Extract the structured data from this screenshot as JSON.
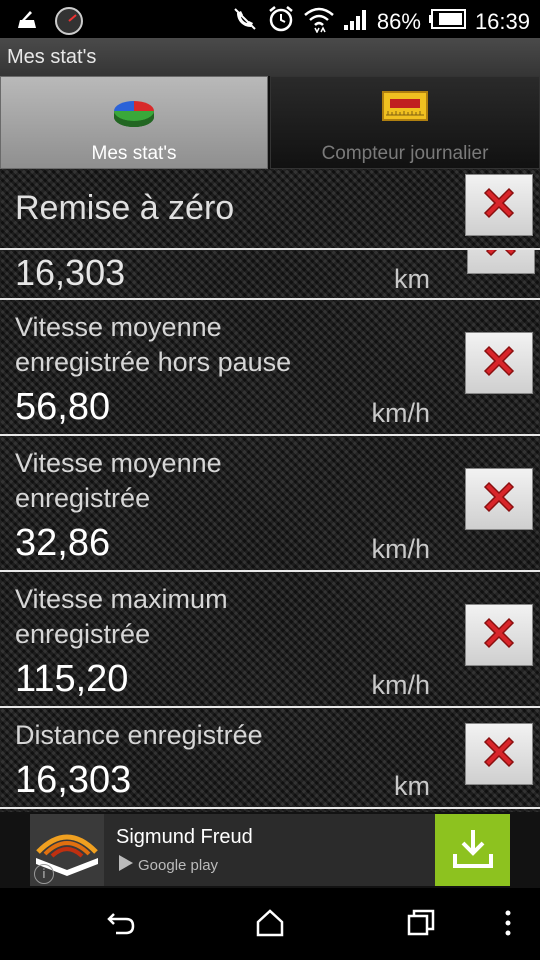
{
  "status_bar": {
    "battery": "86%",
    "time": "16:39",
    "icons": [
      "android-debug-icon",
      "gauge-app-icon",
      "no-call-icon",
      "alarm-clock-icon",
      "wifi-icon",
      "signal-icon",
      "battery-icon"
    ]
  },
  "app": {
    "title": "Mes stat's"
  },
  "tabs": [
    {
      "label": "Mes stat's",
      "icon": "pie-chart-icon",
      "active": true
    },
    {
      "label": "Compteur journalier",
      "icon": "ruler-counter-icon",
      "active": false
    }
  ],
  "reset_label": "Remise à zéro",
  "stats": [
    {
      "label_lines": [],
      "value": "16,303",
      "unit": "km"
    },
    {
      "label_lines": [
        "Vitesse moyenne",
        "enregistrée hors pause"
      ],
      "value": "56,80",
      "unit": "km/h"
    },
    {
      "label_lines": [
        "Vitesse moyenne",
        "enregistrée"
      ],
      "value": "32,86",
      "unit": "km/h"
    },
    {
      "label_lines": [
        "Vitesse maximum",
        "enregistrée"
      ],
      "value": "115,20",
      "unit": "km/h"
    },
    {
      "label_lines": [
        "Distance enregistrée"
      ],
      "value": "16,303",
      "unit": "km"
    }
  ],
  "ad": {
    "title": "Sigmund Freud",
    "store": "Google play",
    "info": "i"
  },
  "colors": {
    "accent_green": "#8dc21f",
    "delete_red": "#d8252a"
  },
  "nav": [
    "back-icon",
    "home-icon",
    "recents-icon",
    "menu-icon"
  ]
}
